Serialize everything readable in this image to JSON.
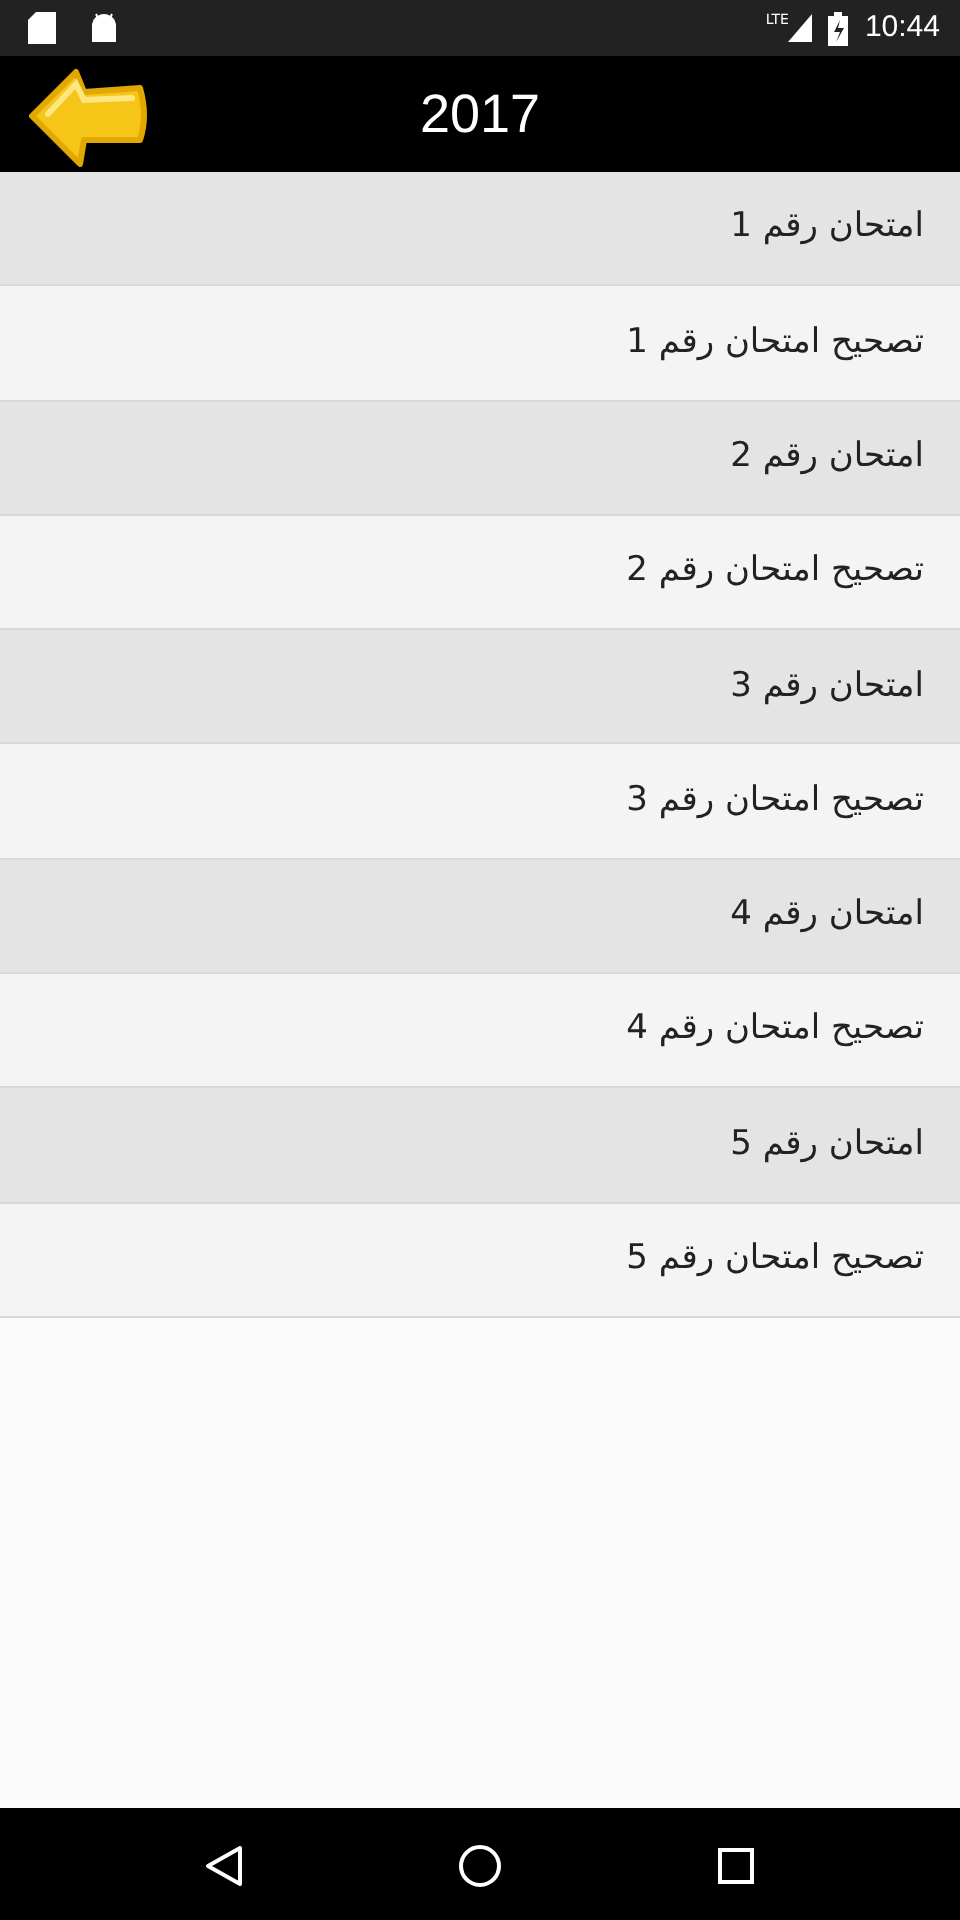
{
  "status_bar": {
    "time": "10:44",
    "network": "LTE"
  },
  "header": {
    "title": "2017"
  },
  "items": [
    {
      "label": "امتحان رقم 1",
      "kind": "exam"
    },
    {
      "label": "تصحيح امتحان رقم 1",
      "kind": "correction"
    },
    {
      "label": "امتحان رقم 2",
      "kind": "exam"
    },
    {
      "label": "تصحيح امتحان رقم 2",
      "kind": "correction"
    },
    {
      "label": "امتحان رقم 3",
      "kind": "exam"
    },
    {
      "label": "تصحيح امتحان رقم 3",
      "kind": "correction"
    },
    {
      "label": "امتحان رقم 4",
      "kind": "exam"
    },
    {
      "label": "تصحيح امتحان رقم 4",
      "kind": "correction"
    },
    {
      "label": "امتحان رقم 5",
      "kind": "exam"
    },
    {
      "label": "تصحيح امتحان رقم 5",
      "kind": "correction"
    }
  ]
}
